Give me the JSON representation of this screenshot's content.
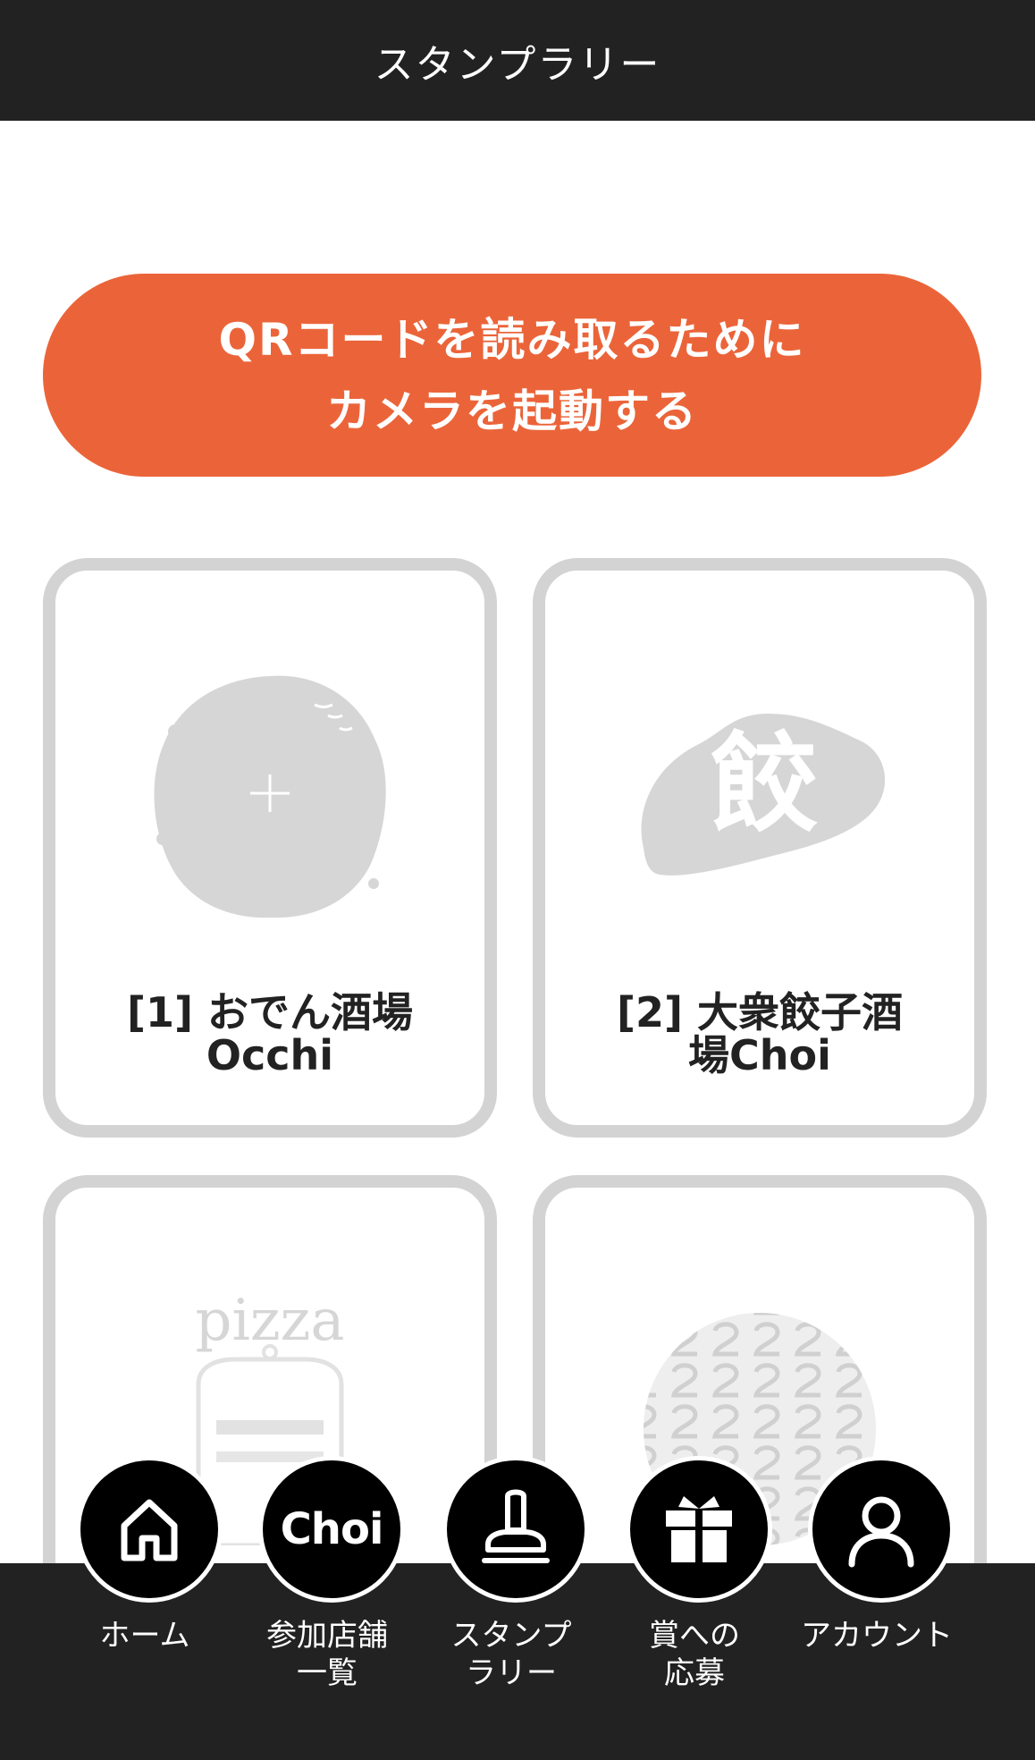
{
  "header": {
    "title": "スタンプラリー"
  },
  "camera_button": {
    "line1": "QRコードを読み取るために",
    "line2": "カメラを起動する",
    "color": "#eb6439"
  },
  "stamps": [
    {
      "line1": "[1] おでん酒場",
      "line2": "Occhi",
      "art": "oden-stamp-icon"
    },
    {
      "line1": "[2] 大衆餃子酒",
      "line2": "場Choi",
      "art": "gyoza-stamp-icon"
    },
    {
      "line1": "",
      "line2": "",
      "art": "pizza-stamp-icon",
      "art_text": "pizza"
    },
    {
      "line1": "",
      "line2": "",
      "art": "pattern-stamp-icon"
    }
  ],
  "stamp_art": {
    "gyoza_char": "餃"
  },
  "nav": {
    "items": [
      {
        "icon": "home-icon",
        "line1": "ホーム",
        "line2": ""
      },
      {
        "icon": "choi-icon",
        "icon_text": "Choi",
        "line1": "参加店舗",
        "line2": "一覧"
      },
      {
        "icon": "stamp-icon",
        "line1": "スタンプ",
        "line2": "ラリー"
      },
      {
        "icon": "gift-icon",
        "line1": "賞への",
        "line2": "応募"
      },
      {
        "icon": "user-icon",
        "line1": "アカウント",
        "line2": ""
      }
    ]
  },
  "colors": {
    "header_bg": "#222222",
    "card_border": "#d3d3d3",
    "stamp_gray": "#d6d6d6"
  }
}
